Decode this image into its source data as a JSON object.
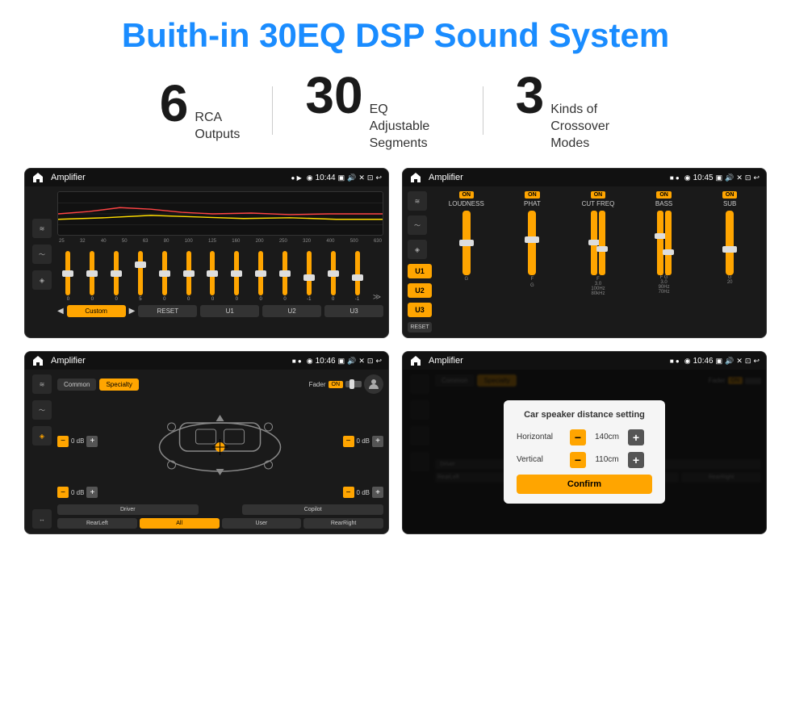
{
  "title": "Buith-in 30EQ DSP Sound System",
  "stats": [
    {
      "number": "6",
      "label": "RCA\nOutputs"
    },
    {
      "number": "30",
      "label": "EQ Adjustable\nSegments"
    },
    {
      "number": "3",
      "label": "Kinds of\nCrossover Modes"
    }
  ],
  "screens": {
    "eq": {
      "title": "Amplifier",
      "time": "10:44",
      "freq_labels": [
        "25",
        "32",
        "40",
        "50",
        "63",
        "80",
        "100",
        "125",
        "160",
        "200",
        "250",
        "320",
        "400",
        "500",
        "630"
      ],
      "slider_values": [
        "0",
        "0",
        "0",
        "5",
        "0",
        "0",
        "0",
        "0",
        "0",
        "0",
        "-1",
        "0",
        "-1"
      ],
      "bottom_btns": [
        "Custom",
        "RESET",
        "U1",
        "U2",
        "U3"
      ]
    },
    "crossover": {
      "title": "Amplifier",
      "time": "10:45",
      "u_buttons": [
        "U1",
        "U2",
        "U3"
      ],
      "channels": [
        "LOUDNESS",
        "PHAT",
        "CUT FREQ",
        "BASS",
        "SUB"
      ],
      "on_labels": [
        "ON",
        "ON",
        "ON",
        "ON",
        "ON"
      ]
    },
    "speaker": {
      "title": "Amplifier",
      "time": "10:46",
      "tabs": [
        "Common",
        "Specialty"
      ],
      "fader_label": "Fader",
      "on_label": "ON",
      "db_values": [
        "0 dB",
        "0 dB",
        "0 dB",
        "0 dB"
      ],
      "bottom_btns": [
        "Driver",
        "",
        "Copilot",
        "RearLeft",
        "All",
        "User",
        "RearRight"
      ]
    },
    "distance": {
      "title": "Amplifier",
      "time": "10:46",
      "dialog_title": "Car speaker distance setting",
      "horizontal_label": "Horizontal",
      "horizontal_value": "140cm",
      "vertical_label": "Vertical",
      "vertical_value": "110cm",
      "confirm_label": "Confirm",
      "minus_label": "−",
      "plus_label": "+"
    }
  },
  "icons": {
    "home": "⌂",
    "back": "↩",
    "location": "◉",
    "camera": "📷",
    "volume": "🔊",
    "close": "✕",
    "expand": "⊡",
    "menu_dots": "⋮",
    "play": "▶",
    "pause": "⏸",
    "settings": "⚙",
    "eq_icon": "≋",
    "wave_icon": "〜",
    "speaker_icon": "◈"
  }
}
